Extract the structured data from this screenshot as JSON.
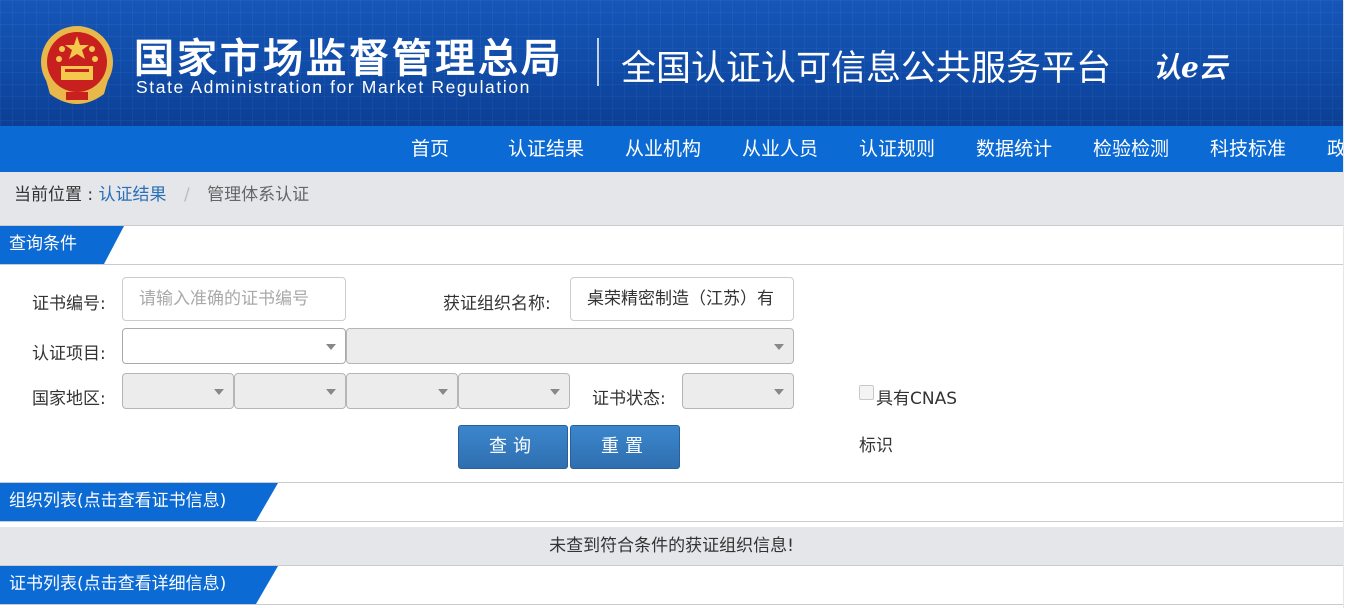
{
  "header": {
    "cn_title": "国家市场监督管理总局",
    "en_title": "State Administration  for  Market Regulation",
    "platform_title": "全国认证认可信息公共服务平台",
    "cloud_logo_text": "认e云",
    "brand_color": "#1050ad",
    "emblem_icon": "national-emblem-icon"
  },
  "nav": {
    "items": [
      "首页",
      "认证结果",
      "从业机构",
      "从业人员",
      "认证规则",
      "数据统计",
      "检验检测",
      "科技标准",
      "政"
    ],
    "color": "#0b6ad3"
  },
  "breadcrumb": {
    "label": "当前位置 :",
    "link": "认证结果",
    "separator": "/",
    "current": "管理体系认证"
  },
  "query": {
    "section_title": "查询条件",
    "cert_no_label": "证书编号:",
    "cert_no_placeholder": "请输入准确的证书编号",
    "cert_no_value": "",
    "org_name_label": "获证组织名称:",
    "org_name_value": "桌荣精密制造（江苏）有",
    "project_label": "认证项目:",
    "region_label": "国家地区:",
    "status_label": "证书状态:",
    "cnas_label_line1": "具有CNAS",
    "cnas_label_line2": "标识",
    "cnas_checked": false,
    "search_button": "查询",
    "reset_button": "重置",
    "button_color": "#3478bf"
  },
  "org_list": {
    "section_title": "组织列表(点击查看证书信息)",
    "empty_message": "未查到符合条件的获证组织信息!"
  },
  "cert_list": {
    "section_title": "证书列表(点击查看详细信息)"
  },
  "tab_color": "#0b6ad3"
}
